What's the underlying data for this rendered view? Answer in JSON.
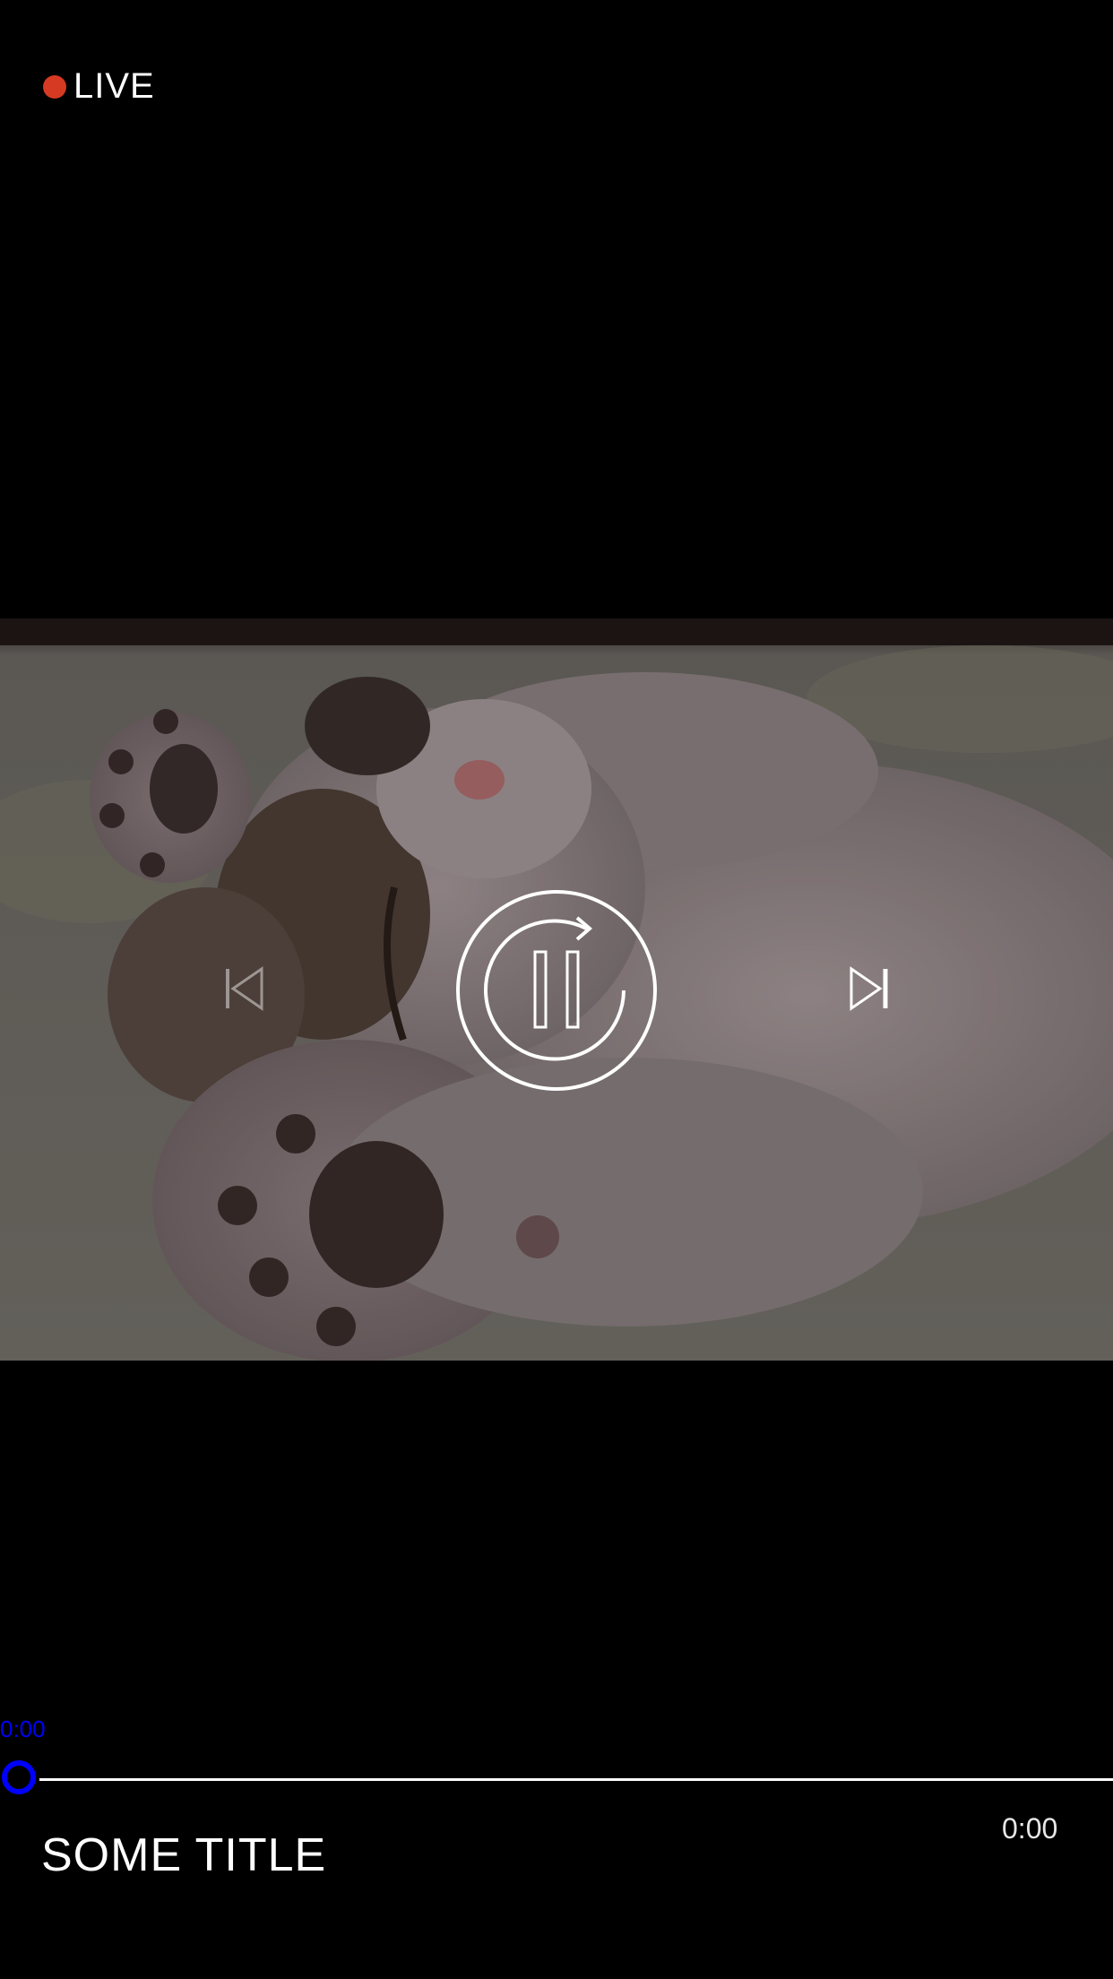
{
  "live": {
    "label": "LIVE",
    "dot_color": "#d63a22"
  },
  "video": {
    "subject": "sleeping-kitten"
  },
  "controls": {
    "previous_icon": "skip-previous-icon",
    "next_icon": "skip-next-icon",
    "play_pause_icon": "pause-replay-icon"
  },
  "seek": {
    "current_time": "0:00",
    "accent_color": "#0000ff",
    "progress": 0
  },
  "duration": "0:00",
  "title": "SOME TITLE"
}
